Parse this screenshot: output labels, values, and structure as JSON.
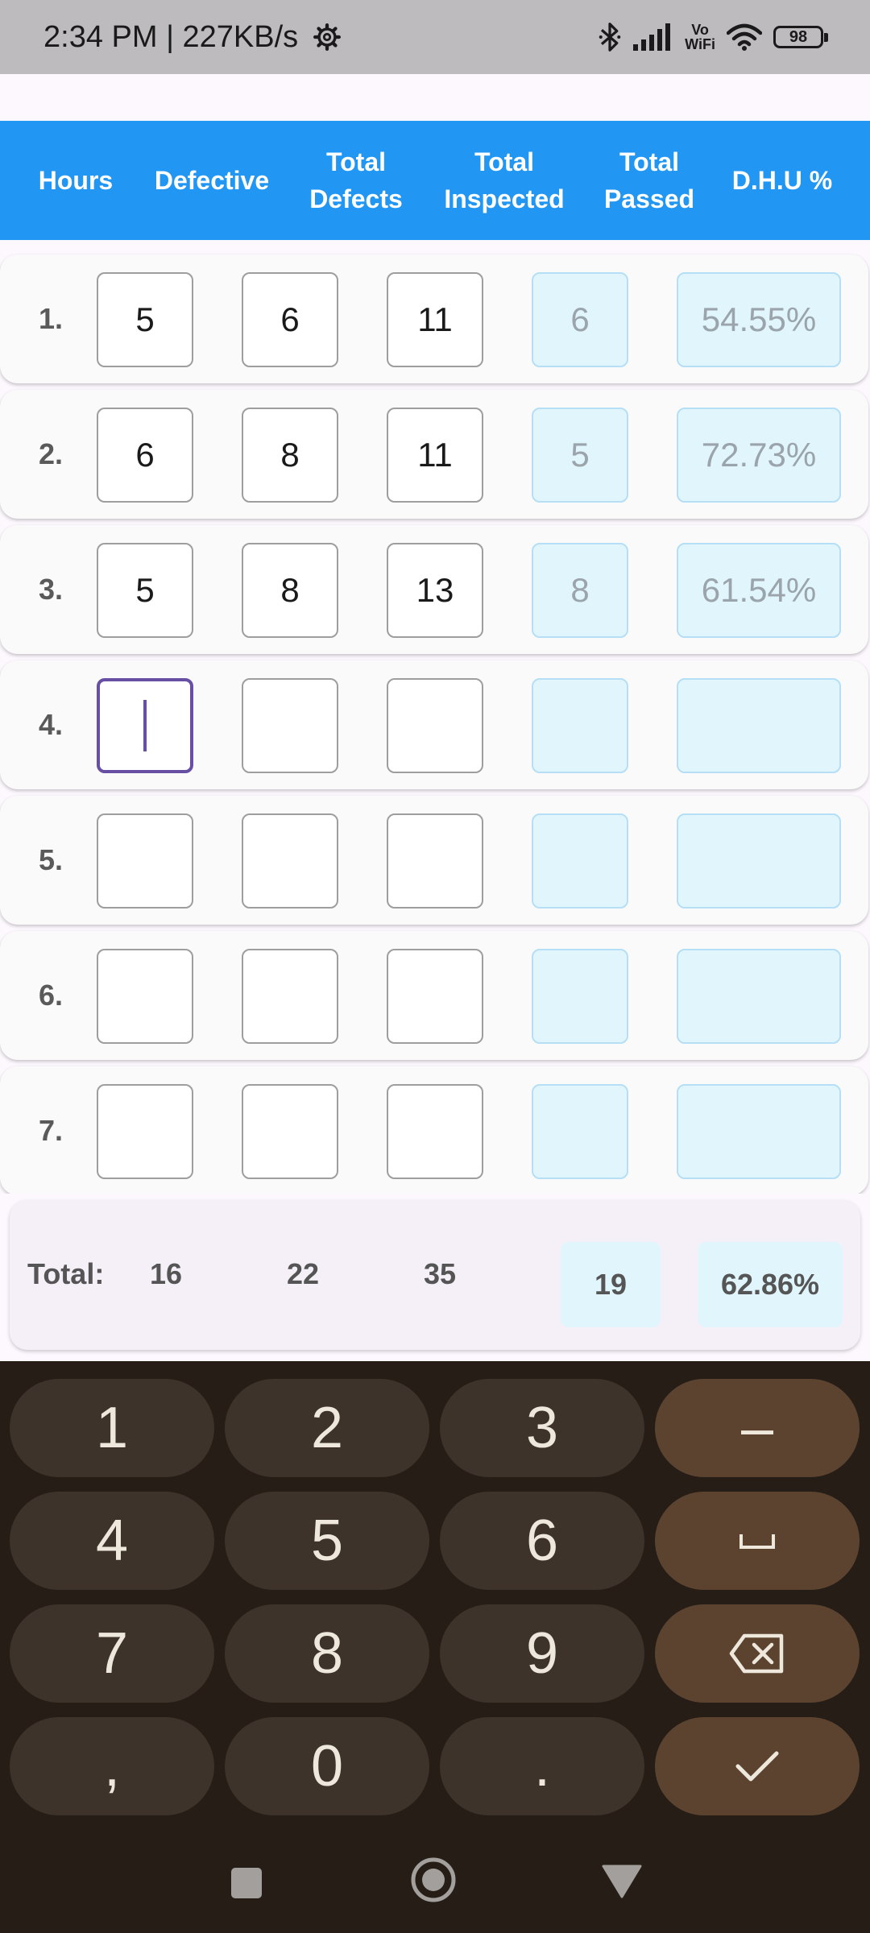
{
  "status_bar": {
    "time_text": "2:34 PM | 227KB/s",
    "vowifi_line1": "Vo",
    "vowifi_line2": "WiFi",
    "battery": "98"
  },
  "header": {
    "columns": [
      {
        "line1": "Hours",
        "line2": ""
      },
      {
        "line1": "Defective",
        "line2": ""
      },
      {
        "line1": "Total",
        "line2": "Defects"
      },
      {
        "line1": "Total",
        "line2": "Inspected"
      },
      {
        "line1": "Total",
        "line2": "Passed"
      },
      {
        "line1": "D.H.U %",
        "line2": ""
      }
    ]
  },
  "rows": [
    {
      "number": "1.",
      "defective": "5",
      "total_defects": "6",
      "total_inspected": "11",
      "total_passed": "6",
      "dhu": "54.55%"
    },
    {
      "number": "2.",
      "defective": "6",
      "total_defects": "8",
      "total_inspected": "11",
      "total_passed": "5",
      "dhu": "72.73%"
    },
    {
      "number": "3.",
      "defective": "5",
      "total_defects": "8",
      "total_inspected": "13",
      "total_passed": "8",
      "dhu": "61.54%"
    },
    {
      "number": "4.",
      "defective": "",
      "total_defects": "",
      "total_inspected": "",
      "total_passed": "",
      "dhu": ""
    },
    {
      "number": "5.",
      "defective": "",
      "total_defects": "",
      "total_inspected": "",
      "total_passed": "",
      "dhu": ""
    },
    {
      "number": "6.",
      "defective": "",
      "total_defects": "",
      "total_inspected": "",
      "total_passed": "",
      "dhu": ""
    },
    {
      "number": "7.",
      "defective": "",
      "total_defects": "",
      "total_inspected": "",
      "total_passed": "",
      "dhu": ""
    }
  ],
  "totals": {
    "label": "Total:",
    "defective": "16",
    "total_defects": "22",
    "total_inspected": "35",
    "total_passed": "19",
    "dhu": "62.86%"
  },
  "keyboard": {
    "keys": [
      "1",
      "2",
      "3",
      "–",
      "4",
      "5",
      "6",
      "␣",
      "7",
      "8",
      "9",
      "backspace",
      ",",
      "0",
      ".",
      "done"
    ]
  },
  "colors": {
    "header_bg": "#2196f3",
    "focus_border": "#6750a4",
    "readonly_bg": "#e1f5fd",
    "keyboard_bg": "#261d16"
  }
}
